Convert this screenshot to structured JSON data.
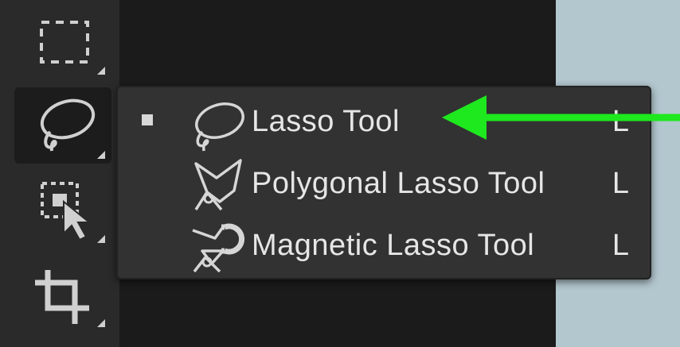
{
  "toolbar": {
    "tools": [
      {
        "name": "rectangular-marquee-tool",
        "icon": "marquee-icon"
      },
      {
        "name": "lasso-tool",
        "icon": "lasso-icon",
        "active": true
      },
      {
        "name": "object-selection-tool",
        "icon": "object-selection-icon"
      },
      {
        "name": "crop-tool",
        "icon": "crop-icon"
      }
    ]
  },
  "flyout": {
    "items": [
      {
        "label": "Lasso Tool",
        "shortcut": "L",
        "selected": true,
        "icon": "lasso-icon"
      },
      {
        "label": "Polygonal Lasso Tool",
        "shortcut": "L",
        "selected": false,
        "icon": "polygonal-lasso-icon"
      },
      {
        "label": "Magnetic Lasso Tool",
        "shortcut": "L",
        "selected": false,
        "icon": "magnetic-lasso-icon"
      }
    ]
  },
  "annotation": {
    "arrow_color": "#1ee81e"
  },
  "colors": {
    "toolbar_bg": "#2a2a2a",
    "menu_bg": "#323232",
    "text": "#e6e6e6",
    "canvas_right": "#b3c7cf"
  }
}
